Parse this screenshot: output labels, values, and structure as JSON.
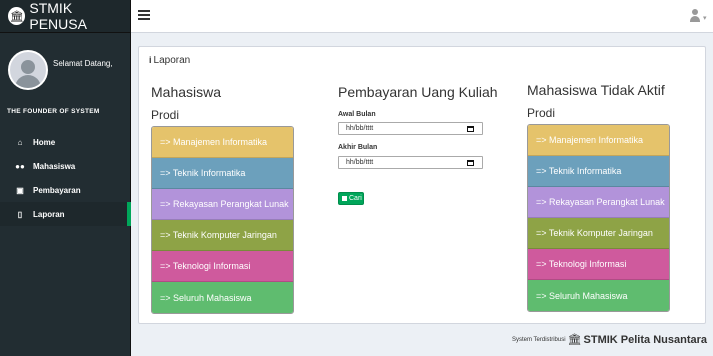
{
  "brand": {
    "title": "STMIK PENUSA"
  },
  "user_panel": {
    "welcome": "Selamat Datang,",
    "tagline": "THE FOUNDER OF SYSTEM"
  },
  "menu": [
    {
      "label": "Home"
    },
    {
      "label": "Mahasiswa"
    },
    {
      "label": "Pembayaran"
    },
    {
      "label": "Laporan"
    }
  ],
  "content": {
    "box_title": "Laporan",
    "mahasiswa": {
      "title": "Mahasiswa",
      "prodi": "Prodi",
      "items": [
        {
          "label": "=> Manajemen Informatika",
          "color": "#e5c36b"
        },
        {
          "label": "=> Teknik Informatika",
          "color": "#6ca0bc"
        },
        {
          "label": "=> Rekayasan Perangkat Lunak",
          "color": "#b293da"
        },
        {
          "label": "=> Teknik Komputer Jaringan",
          "color": "#8ea346"
        },
        {
          "label": "=> Teknologi Informasi",
          "color": "#cf5a9d"
        },
        {
          "label": "=> Seluruh Mahasiswa",
          "color": "#5fbc6f"
        }
      ]
    },
    "pembayaran": {
      "title": "Pembayaran Uang Kuliah",
      "awal_label": "Awal Bulan",
      "awal_value": "hh/bb/tttt",
      "akhir_label": "Akhir Bulan",
      "akhir_value": "hh/bb/tttt",
      "cari_label": "Cari"
    },
    "tidak_aktif": {
      "title": "Mahasiswa Tidak Aktif",
      "prodi": "Prodi",
      "items": [
        {
          "label": "=> Manajemen Informatika",
          "color": "#e5c36b"
        },
        {
          "label": "=> Teknik Informatika",
          "color": "#6ca0bc"
        },
        {
          "label": "=> Rekayasan Perangkat Lunak",
          "color": "#b293da"
        },
        {
          "label": "=> Teknik Komputer Jaringan",
          "color": "#8ea346"
        },
        {
          "label": "=> Teknologi Informasi",
          "color": "#cf5a9d"
        },
        {
          "label": "=> Seluruh Mahasiswa",
          "color": "#5fbc6f"
        }
      ]
    }
  },
  "footer": {
    "prefix": "System Terdistribusi",
    "name": "STMIK Pelita Nusantara"
  }
}
